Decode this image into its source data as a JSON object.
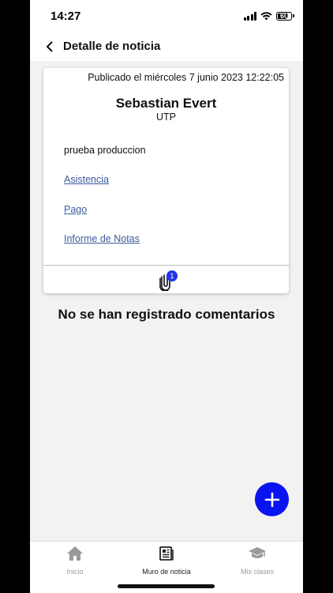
{
  "status_bar": {
    "time": "14:27",
    "battery": "60"
  },
  "header": {
    "title": "Detalle de noticia"
  },
  "news": {
    "published": "Publicado el miércoles 7 junio 2023 12:22:05",
    "author": "Sebastian Evert",
    "organization": "UTP",
    "body": "prueba produccion",
    "links": [
      "Asistencia",
      "Pago",
      "Informe de Notas"
    ],
    "attachments_count": "1"
  },
  "comments": {
    "empty_message": "No se han registrado comentarios"
  },
  "bottom_nav": {
    "items": [
      {
        "label": "Inicio",
        "icon": "home-icon"
      },
      {
        "label": "Muro de noticia",
        "icon": "newspaper-icon"
      },
      {
        "label": "Mis clases",
        "icon": "graduation-cap-icon"
      }
    ]
  },
  "colors": {
    "accent": "#0a14f0",
    "link": "#3b5a9d",
    "badge": "#1f35e8"
  }
}
